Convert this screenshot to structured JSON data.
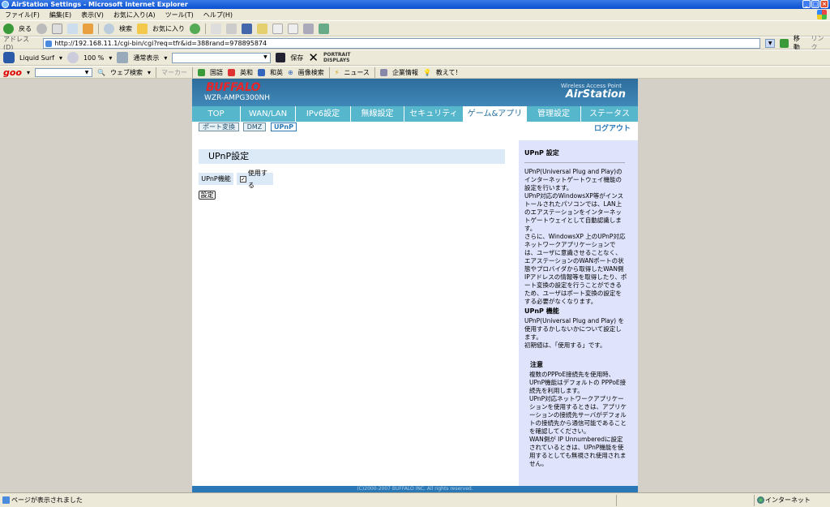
{
  "window": {
    "title": "AirStation Settings - Microsoft Internet Explorer"
  },
  "menu": [
    "ファイル(F)",
    "編集(E)",
    "表示(V)",
    "お気に入り(A)",
    "ツール(T)",
    "ヘルプ(H)"
  ],
  "toolbar": {
    "back": "戻る",
    "search": "検索",
    "favorites": "お気に入り"
  },
  "address": {
    "label": "アドレス(D)",
    "url": "http://192.168.11.1/cgi-bin/cgi?req=tfr&id=388rand=978895874",
    "go": "移動",
    "links": "リンク"
  },
  "toolbar2": {
    "liquid": "Liquid Surf",
    "zoom": "100 %",
    "view": "通常表示",
    "save": "保存",
    "portrait1": "PORTRAIT",
    "portrait2": "DISPLAYS"
  },
  "goo": {
    "logo": "goo",
    "web_search": "ウェブ検索",
    "marker": "マーカー",
    "links": [
      "国語",
      "英和",
      "和英",
      "画像検索",
      "ニュース",
      "企業情報",
      "教えて！"
    ]
  },
  "router": {
    "brand": "BUFFALO",
    "model": "WZR-AMPG300NH",
    "tagline": "Wireless Access Point",
    "product": "AirStation"
  },
  "nav": {
    "tabs": [
      {
        "label": "TOP"
      },
      {
        "label": "WAN/LAN"
      },
      {
        "label": "IPv6設定"
      },
      {
        "label": "無線設定"
      },
      {
        "label": "セキュリティ"
      },
      {
        "label": "ゲーム&アプリ"
      },
      {
        "label": "管理設定"
      },
      {
        "label": "ステータス"
      }
    ],
    "active": "ゲーム&アプリ"
  },
  "subnav": {
    "items": [
      "ポート変換",
      "DMZ",
      "UPnP"
    ],
    "active": "UPnP",
    "logout": "ログアウト"
  },
  "page": {
    "title": "UPnP設定",
    "field_label": "UPnP機能",
    "checkbox_label": "使用する",
    "checkbox_checked": true,
    "submit": "設定"
  },
  "help": {
    "title1": "UPnP 設定",
    "text1": "UPnP(Universal Plug and Play)のインターネットゲートウェイ機能の設定を行います。\nUPnP対応のWindowsXP等がインストールされたパソコンでは、LAN上のエアステーションをインターネットゲートウェイとして自動認識します。\nさらに、WindowsXP 上のUPnP対応ネットワークアプリケーションでは、ユーザに意識させることなく、エアステーションのWANポートの状態やプロバイダから取得したWAN側IPアドレスの情報等を取得したり、ポート変換の設定を行うことができるため、ユーザはポート変換の設定をする必要がなくなります。",
    "title2": "UPnP 機能",
    "text2": "UPnP(Universal Plug and Play) を使用するかしないかについて設定します。\n初期値は、「使用する」です。",
    "note_title": "注意",
    "note_text": "複数のPPPoE接続先を使用時、UPnP機能はデフォルトの PPPoE接続先を利用します。\nUPnP対応ネットワークアプリケーションを使用するときは、アプリケーションの接続先サーバがデフォルトの接続先から通信可能であることを確認してください。\nWAN側が IP Unnumberedに設定されているときは、UPnP機能を使用するとしても無視され使用されません。"
  },
  "footer": "(C)2000-2007 BUFFALO INC. All rights reserved.",
  "status": {
    "message": "ページが表示されました",
    "zone": "インターネット"
  }
}
